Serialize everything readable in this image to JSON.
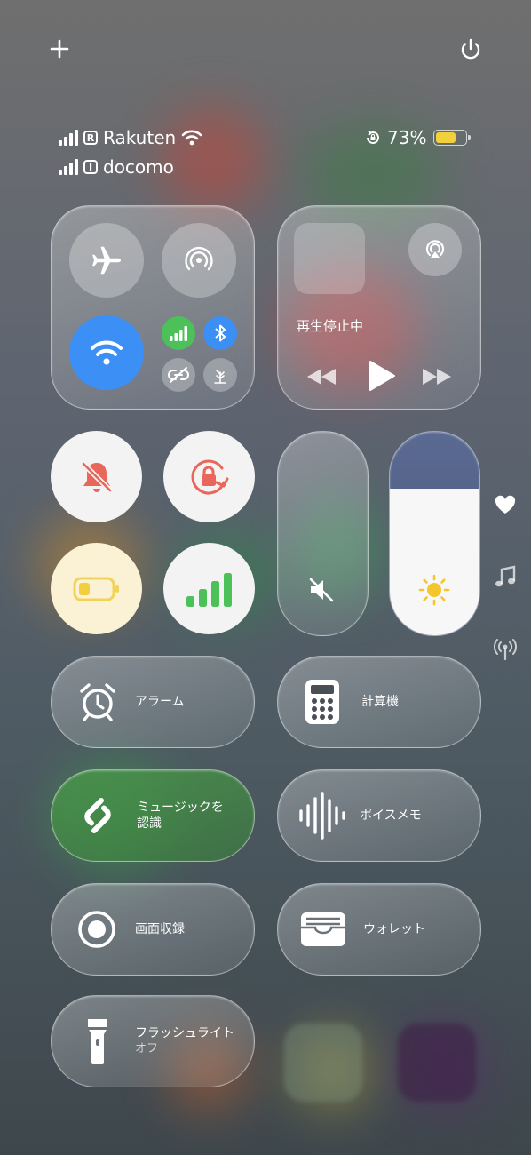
{
  "status": {
    "carrier1": "Rakuten",
    "sim1_badge": "R",
    "carrier2": "docomo",
    "sim2_badge": "I",
    "battery_percent": "73%",
    "battery_level": 0.73,
    "battery_color": "#f2cf3c"
  },
  "media": {
    "status": "再生停止中"
  },
  "connectivity": {
    "wifi_color": "#3b8ff5",
    "cellular_color": "#4cc15a",
    "bluetooth_color": "#3b8ff5"
  },
  "sliders": {
    "volume_level": 0.0,
    "brightness_level": 0.72
  },
  "controls": {
    "alarm": "アラーム",
    "calculator": "計算機",
    "shazam_line1": "ミュージックを",
    "shazam_line2": "認識",
    "voice_memo": "ボイスメモ",
    "screen_record": "画面収録",
    "wallet": "ウォレット",
    "flashlight": "フラッシュライト",
    "flashlight_state": "オフ"
  },
  "icons": [
    "plus-icon",
    "power-icon",
    "airplane-icon",
    "airdrop-icon",
    "wifi-icon",
    "cellular-icon",
    "bluetooth-icon",
    "hotspot-icon",
    "focus-icon",
    "airplay-icon",
    "rewind-icon",
    "play-icon",
    "fast-forward-icon",
    "silent-mode-icon",
    "rotation-lock-icon",
    "low-power-icon",
    "signal-icon",
    "mute-icon",
    "brightness-icon",
    "heart-icon",
    "music-note-icon",
    "antenna-icon",
    "alarm-icon",
    "calculator-icon",
    "shazam-icon",
    "waveform-icon",
    "record-icon",
    "wallet-icon",
    "flashlight-icon"
  ]
}
